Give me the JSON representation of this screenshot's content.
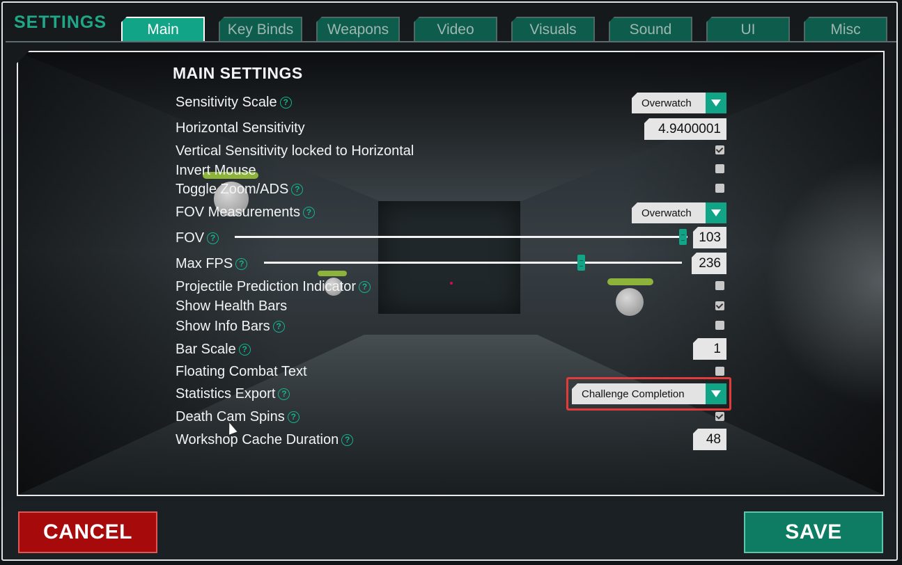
{
  "window": {
    "title": "SETTINGS"
  },
  "tabs": [
    {
      "label": "Main",
      "active": true
    },
    {
      "label": "Key Binds",
      "active": false
    },
    {
      "label": "Weapons",
      "active": false
    },
    {
      "label": "Video",
      "active": false
    },
    {
      "label": "Visuals",
      "active": false
    },
    {
      "label": "Sound",
      "active": false
    },
    {
      "label": "UI",
      "active": false
    },
    {
      "label": "Misc",
      "active": false
    }
  ],
  "main": {
    "section_title": "MAIN SETTINGS",
    "help_glyph": "?",
    "settings": [
      {
        "label": "Sensitivity Scale",
        "help": true,
        "control": "dropdown",
        "value": "Overwatch"
      },
      {
        "label": "Horizontal Sensitivity",
        "help": false,
        "control": "number",
        "value": "4.9400001"
      },
      {
        "label": "Vertical Sensitivity locked to Horizontal",
        "help": false,
        "control": "checkbox",
        "checked": true
      },
      {
        "label": "Invert Mouse",
        "help": false,
        "control": "checkbox",
        "checked": false
      },
      {
        "label": "Toggle Zoom/ADS",
        "help": true,
        "control": "checkbox",
        "checked": false
      },
      {
        "label": "FOV Measurements",
        "help": true,
        "control": "dropdown",
        "value": "Overwatch"
      },
      {
        "label": "FOV",
        "help": true,
        "control": "slider",
        "value": "103",
        "fraction": 1.0
      },
      {
        "label": "Max FPS",
        "help": true,
        "control": "slider",
        "value": "236",
        "fraction": 0.76
      },
      {
        "label": "Projectile Prediction Indicator",
        "help": true,
        "control": "checkbox",
        "checked": false
      },
      {
        "label": "Show Health Bars",
        "help": false,
        "control": "checkbox",
        "checked": true
      },
      {
        "label": "Show Info Bars",
        "help": true,
        "control": "checkbox",
        "checked": false
      },
      {
        "label": "Bar Scale",
        "help": true,
        "control": "number",
        "value": "1"
      },
      {
        "label": "Floating Combat Text",
        "help": false,
        "control": "checkbox",
        "checked": false
      },
      {
        "label": "Statistics Export",
        "help": true,
        "control": "dropdown",
        "value": "Challenge Completion",
        "highlighted": true
      },
      {
        "label": "Death Cam Spins",
        "help": true,
        "control": "checkbox",
        "checked": true
      },
      {
        "label": "Workshop Cache Duration",
        "help": true,
        "control": "number",
        "value": "48"
      }
    ]
  },
  "footer": {
    "cancel_label": "CANCEL",
    "save_label": "SAVE"
  },
  "colors": {
    "accent": "#12a487",
    "title": "#1fa887",
    "cancel": "#a70a0a",
    "save": "#0d7c62",
    "highlight": "#e33a3a"
  }
}
